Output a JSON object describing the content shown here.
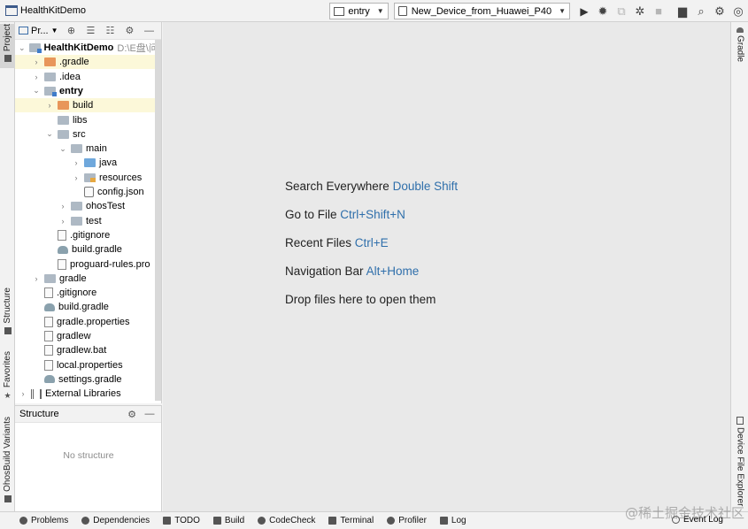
{
  "window": {
    "title": "HealthKitDemo"
  },
  "toolbar": {
    "module_selector": "entry",
    "device_selector": "New_Device_from_Huawei_P40"
  },
  "left_stripe": {
    "project_tab": "Project",
    "structure_tab": "Structure",
    "favorites_tab": "Favorites",
    "build_variants_tab": "OhosBuild Variants"
  },
  "right_stripe": {
    "gradle_tab": "Gradle",
    "device_file_explorer_tab": "Device File Explorer"
  },
  "project_panel": {
    "view_label": "Pr...",
    "tree": [
      {
        "label": "HealthKitDemo",
        "path": "D:\\E盘\\问题",
        "bold": true,
        "depth": 0,
        "expanded": true,
        "icon": "module-folder-icon"
      },
      {
        "label": ".gradle",
        "depth": 1,
        "expanded": false,
        "icon": "orange-folder-icon",
        "highlight": true
      },
      {
        "label": ".idea",
        "depth": 1,
        "expanded": false,
        "icon": "folder-icon"
      },
      {
        "label": "entry",
        "bold": true,
        "depth": 1,
        "expanded": true,
        "icon": "module-folder-icon"
      },
      {
        "label": "build",
        "depth": 2,
        "expanded": false,
        "icon": "orange-folder-icon",
        "highlight": true
      },
      {
        "label": "libs",
        "depth": 2,
        "icon": "folder-icon"
      },
      {
        "label": "src",
        "depth": 2,
        "expanded": true,
        "icon": "folder-icon"
      },
      {
        "label": "main",
        "depth": 3,
        "expanded": true,
        "icon": "folder-icon"
      },
      {
        "label": "java",
        "depth": 4,
        "expanded": false,
        "icon": "blue-folder-icon"
      },
      {
        "label": "resources",
        "depth": 4,
        "expanded": false,
        "icon": "resources-folder-icon"
      },
      {
        "label": "config.json",
        "depth": 4,
        "icon": "config-file-icon"
      },
      {
        "label": "ohosTest",
        "depth": 3,
        "expanded": false,
        "icon": "folder-icon"
      },
      {
        "label": "test",
        "depth": 3,
        "expanded": false,
        "icon": "folder-icon"
      },
      {
        "label": ".gitignore",
        "depth": 2,
        "icon": "file-icon"
      },
      {
        "label": "build.gradle",
        "depth": 2,
        "icon": "gradle-icon"
      },
      {
        "label": "proguard-rules.pro",
        "depth": 2,
        "icon": "file-icon"
      },
      {
        "label": "gradle",
        "depth": 1,
        "expanded": false,
        "icon": "folder-icon"
      },
      {
        "label": ".gitignore",
        "depth": 1,
        "icon": "file-icon"
      },
      {
        "label": "build.gradle",
        "depth": 1,
        "icon": "gradle-icon"
      },
      {
        "label": "gradle.properties",
        "depth": 1,
        "icon": "properties-file-icon"
      },
      {
        "label": "gradlew",
        "depth": 1,
        "icon": "file-icon"
      },
      {
        "label": "gradlew.bat",
        "depth": 1,
        "icon": "file-icon"
      },
      {
        "label": "local.properties",
        "depth": 1,
        "icon": "properties-file-icon"
      },
      {
        "label": "settings.gradle",
        "depth": 1,
        "icon": "gradle-icon"
      },
      {
        "label": "External Libraries",
        "depth": 0,
        "expanded": false,
        "icon": "library-icon"
      }
    ]
  },
  "structure_panel": {
    "title": "Structure",
    "empty_text": "No structure"
  },
  "editor_hints": [
    {
      "text": "Search Everywhere",
      "key": "Double Shift"
    },
    {
      "text": "Go to File",
      "key": "Ctrl+Shift+N"
    },
    {
      "text": "Recent Files",
      "key": "Ctrl+E"
    },
    {
      "text": "Navigation Bar",
      "key": "Alt+Home"
    },
    {
      "text": "Drop files here to open them",
      "key": ""
    }
  ],
  "bottom_tabs": [
    {
      "label": "Problems",
      "icon": "problems-icon"
    },
    {
      "label": "Dependencies",
      "icon": "dependencies-icon"
    },
    {
      "label": "TODO",
      "icon": "todo-icon"
    },
    {
      "label": "Build",
      "icon": "build-icon"
    },
    {
      "label": "CodeCheck",
      "icon": "codecheck-icon"
    },
    {
      "label": "Terminal",
      "icon": "terminal-icon"
    },
    {
      "label": "Profiler",
      "icon": "profiler-icon"
    },
    {
      "label": "Log",
      "icon": "log-icon"
    }
  ],
  "event_log": "Event Log",
  "watermark": "@稀土掘金技术社区",
  "colors": {
    "highlight_row": "#fcf8d9",
    "shortcut_key": "#2f6fab",
    "editor_bg": "#e9e9e9"
  }
}
